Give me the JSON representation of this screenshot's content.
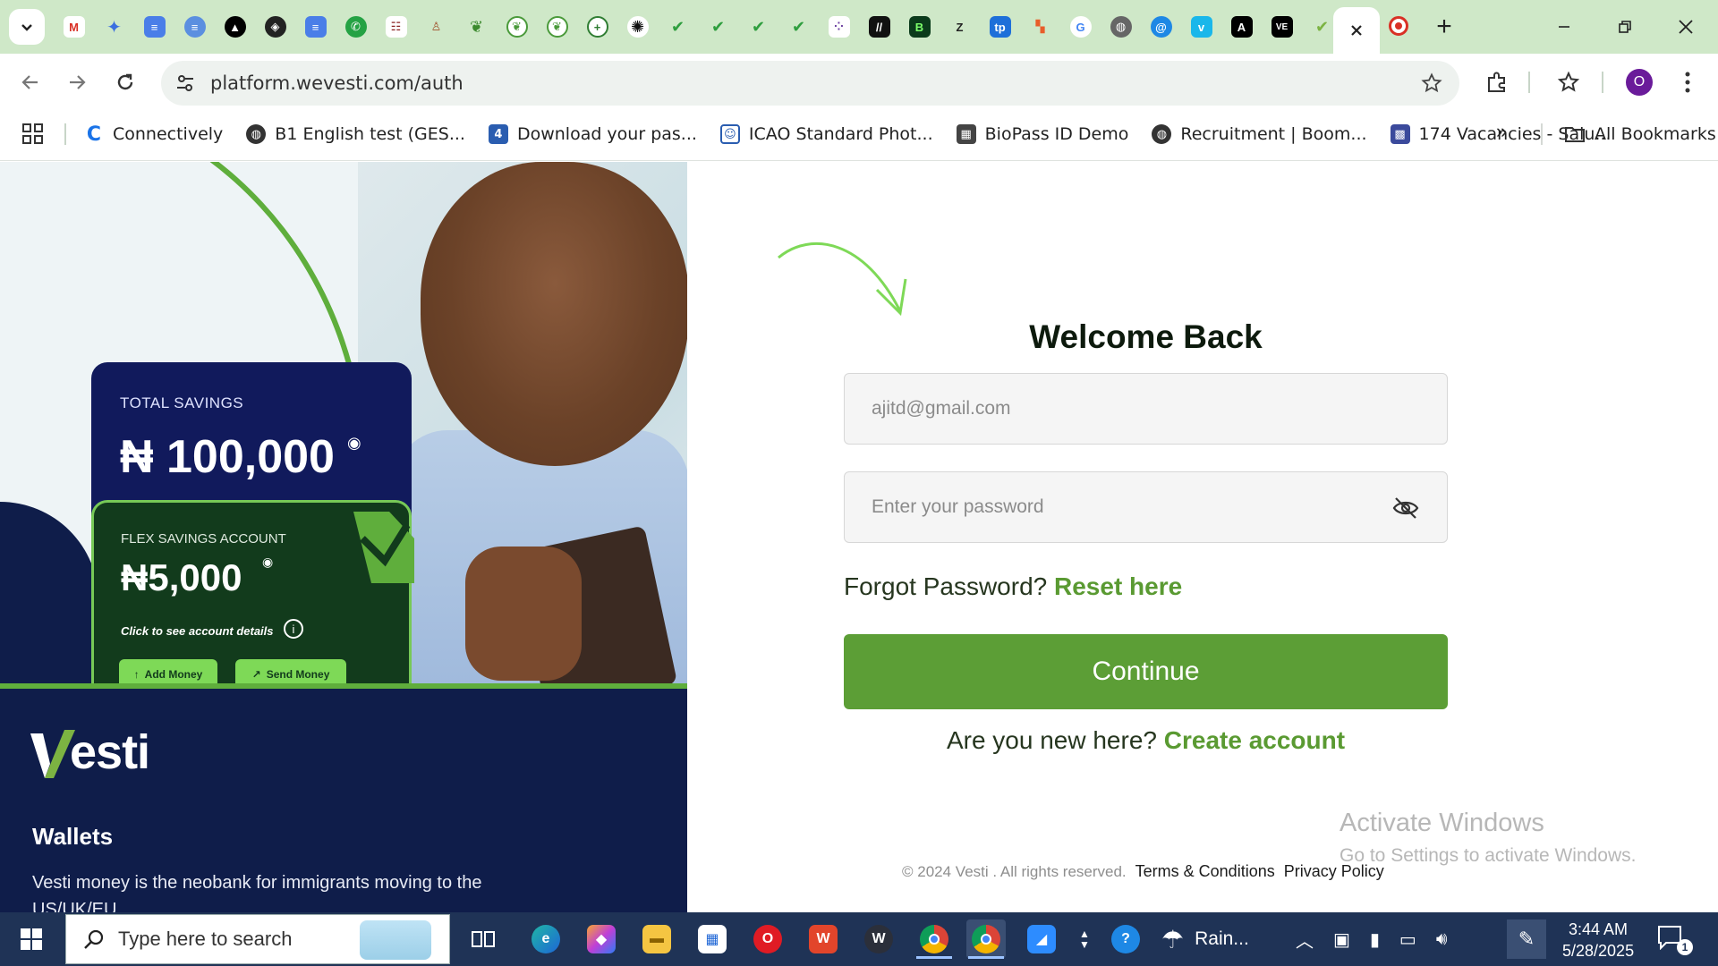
{
  "browser": {
    "url": "platform.wevesti.com/auth",
    "profile_initial": "O",
    "bookmarks": [
      {
        "label": "Connectively",
        "icon": "connectively-icon",
        "color": "#1a73e8"
      },
      {
        "label": "B1 English test (GES...",
        "icon": "globe-icon",
        "color": "#333333"
      },
      {
        "label": "Download your pas...",
        "icon": "four-icon",
        "color": "#2a5db0"
      },
      {
        "label": "ICAO Standard Phot...",
        "icon": "portrait-icon",
        "color": "#2a5db0"
      },
      {
        "label": "BioPass ID Demo",
        "icon": "biopass-icon",
        "color": "#444444"
      },
      {
        "label": "Recruitment | Boom...",
        "icon": "globe-icon",
        "color": "#333333"
      },
      {
        "label": "174 Vacancies - Salu...",
        "icon": "grid-logo-icon",
        "color": "#3b4a9c"
      }
    ],
    "all_bookmarks": "All Bookmarks"
  },
  "hero": {
    "total_savings_label": "TOTAL SAVINGS",
    "total_savings_amount": "₦ 100,000",
    "flex_label": "FLEX SAVINGS ACCOUNT",
    "flex_amount": "₦5,000",
    "flex_hint": "Click to see account details",
    "add_money": "Add Money",
    "send_money": "Send Money"
  },
  "footer_left": {
    "brand": "esti",
    "wallets_title": "Wallets",
    "wallets_desc": "Vesti money is the neobank for immigrants moving to the US/UK/EU"
  },
  "form": {
    "title": "Welcome Back",
    "email_placeholder": "ajitd@gmail.com",
    "password_placeholder": "Enter your password",
    "forgot_text": "Forgot Password?",
    "forgot_link": "Reset here",
    "continue": "Continue",
    "new_here": "Are you new here?",
    "create_account": "Create account",
    "copyright": "© 2024 Vesti . All rights reserved.",
    "terms": "Terms & Conditions",
    "privacy": "Privacy Policy"
  },
  "watermark": {
    "line1": "Activate Windows",
    "line2": "Go to Settings to activate Windows."
  },
  "taskbar": {
    "search_placeholder": "Type here to search",
    "weather": "Rain...",
    "time": "3:44 AM",
    "date": "5/28/2025",
    "notifications": "1"
  },
  "colors": {
    "brand_green": "#5c9e36",
    "navy": "#0f1d4a",
    "tab_strip": "#cfe8c8"
  }
}
